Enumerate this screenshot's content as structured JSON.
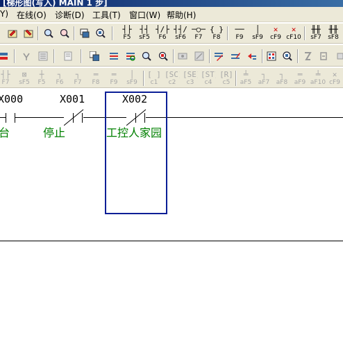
{
  "window": {
    "title": "[梯形图(写入)     MAIN      1 步]"
  },
  "menu": {
    "items": [
      {
        "label": "Y)"
      },
      {
        "label": "在线(O)"
      },
      {
        "label": "诊断(D)"
      },
      {
        "label": "工具(T)"
      },
      {
        "label": "窗口(W)"
      },
      {
        "label": "帮助(H)"
      }
    ]
  },
  "toolbar1": {
    "icons": [
      "write-to-plc-icon",
      "read-from-plc-icon",
      "zoom-in-icon",
      "zoom-out-icon",
      "device-search-icon",
      "monitor-icon"
    ],
    "ladder_buttons": [
      {
        "symbol": "┤├",
        "key": "F5"
      },
      {
        "symbol": "┤┤",
        "key": "sF5"
      },
      {
        "symbol": "┤/├",
        "key": "F6"
      },
      {
        "symbol": "┤┤/",
        "key": "sF6"
      },
      {
        "symbol": "─○─",
        "key": "F7"
      },
      {
        "symbol": "{ }",
        "key": "F8"
      },
      {
        "symbol": "──",
        "key": "F9"
      },
      {
        "symbol": "│",
        "key": "sF9"
      },
      {
        "symbol": "✕",
        "key": "cF9"
      },
      {
        "symbol": "✕",
        "key": "cF10"
      },
      {
        "symbol": "╫╫",
        "key": "sF7"
      },
      {
        "symbol": "╫╫",
        "key": "sF8"
      }
    ]
  },
  "toolbar2": {
    "icons": [
      "ladder-icon",
      "comment-icon",
      "list-icon",
      "list-mode-icon",
      "copy-icon",
      "device-comment-icon",
      "find-icon",
      "search-icon",
      "transfer-icon",
      "settings-icon",
      "ladder-edit-icon",
      "pen-icon",
      "arrow-pen-icon",
      "grid-icon",
      "monitor-start-icon",
      "disabled-icon-1",
      "disabled-icon-2"
    ]
  },
  "toolbar3": {
    "buttons": [
      {
        "symbol": "┤├",
        "key": "F7"
      },
      {
        "symbol": "⊠",
        "key": "sF5"
      },
      {
        "symbol": "┼",
        "key": "F5"
      },
      {
        "symbol": "┐",
        "key": "F6"
      },
      {
        "symbol": "┐",
        "key": "F7"
      },
      {
        "symbol": "═",
        "key": "F8"
      },
      {
        "symbol": "═",
        "key": "F9"
      },
      {
        "symbol": "│",
        "key": "sF9"
      },
      {
        "symbol": "[ ]",
        "key": "c1"
      },
      {
        "symbol": "[SC]",
        "key": "c2"
      },
      {
        "symbol": "[SE]",
        "key": "c3"
      },
      {
        "symbol": "[ST]",
        "key": "c4"
      },
      {
        "symbol": "[R]",
        "key": "c5"
      },
      {
        "symbol": "╧",
        "key": "aF5"
      },
      {
        "symbol": "┐",
        "key": "aF7"
      },
      {
        "symbol": "┐",
        "key": "aF8"
      },
      {
        "symbol": "═",
        "key": "aF9"
      },
      {
        "symbol": "╧",
        "key": "aF10"
      },
      {
        "symbol": "✕",
        "key": "cF9"
      }
    ]
  },
  "ladder": {
    "contacts": [
      {
        "device": "X000",
        "type": "no",
        "comment": "台"
      },
      {
        "device": "X001",
        "type": "nc",
        "comment": "停止"
      },
      {
        "device": "X002",
        "type": "nc",
        "comment": "工控人家园"
      }
    ]
  },
  "colors": {
    "comment": "#008000",
    "cursor": "#0a1e96",
    "toolbar_bg": "#ece9d8"
  }
}
